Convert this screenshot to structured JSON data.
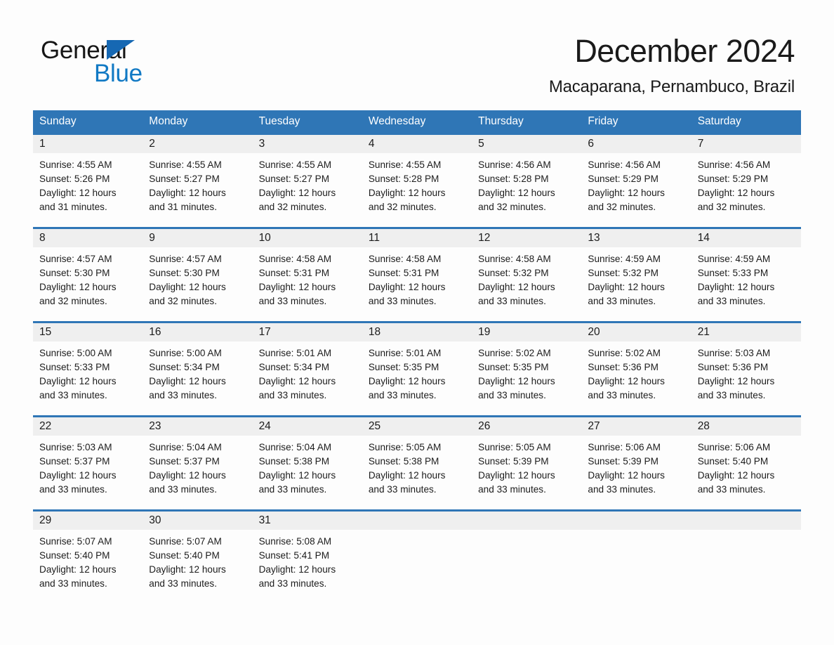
{
  "brand": {
    "name_part1": "General",
    "name_part2": "Blue",
    "triangle_color": "#1668b3",
    "blue_text_color": "#1179c4"
  },
  "header": {
    "month_title": "December 2024",
    "location": "Macaparana, Pernambuco, Brazil",
    "header_bg_color": "#2f76b6",
    "day_band_color": "#efefef"
  },
  "weekdays": [
    "Sunday",
    "Monday",
    "Tuesday",
    "Wednesday",
    "Thursday",
    "Friday",
    "Saturday"
  ],
  "weeks": [
    [
      {
        "day": "1",
        "sunrise": "Sunrise: 4:55 AM",
        "sunset": "Sunset: 5:26 PM",
        "daylight_line1": "Daylight: 12 hours",
        "daylight_line2": "and 31 minutes."
      },
      {
        "day": "2",
        "sunrise": "Sunrise: 4:55 AM",
        "sunset": "Sunset: 5:27 PM",
        "daylight_line1": "Daylight: 12 hours",
        "daylight_line2": "and 31 minutes."
      },
      {
        "day": "3",
        "sunrise": "Sunrise: 4:55 AM",
        "sunset": "Sunset: 5:27 PM",
        "daylight_line1": "Daylight: 12 hours",
        "daylight_line2": "and 32 minutes."
      },
      {
        "day": "4",
        "sunrise": "Sunrise: 4:55 AM",
        "sunset": "Sunset: 5:28 PM",
        "daylight_line1": "Daylight: 12 hours",
        "daylight_line2": "and 32 minutes."
      },
      {
        "day": "5",
        "sunrise": "Sunrise: 4:56 AM",
        "sunset": "Sunset: 5:28 PM",
        "daylight_line1": "Daylight: 12 hours",
        "daylight_line2": "and 32 minutes."
      },
      {
        "day": "6",
        "sunrise": "Sunrise: 4:56 AM",
        "sunset": "Sunset: 5:29 PM",
        "daylight_line1": "Daylight: 12 hours",
        "daylight_line2": "and 32 minutes."
      },
      {
        "day": "7",
        "sunrise": "Sunrise: 4:56 AM",
        "sunset": "Sunset: 5:29 PM",
        "daylight_line1": "Daylight: 12 hours",
        "daylight_line2": "and 32 minutes."
      }
    ],
    [
      {
        "day": "8",
        "sunrise": "Sunrise: 4:57 AM",
        "sunset": "Sunset: 5:30 PM",
        "daylight_line1": "Daylight: 12 hours",
        "daylight_line2": "and 32 minutes."
      },
      {
        "day": "9",
        "sunrise": "Sunrise: 4:57 AM",
        "sunset": "Sunset: 5:30 PM",
        "daylight_line1": "Daylight: 12 hours",
        "daylight_line2": "and 32 minutes."
      },
      {
        "day": "10",
        "sunrise": "Sunrise: 4:58 AM",
        "sunset": "Sunset: 5:31 PM",
        "daylight_line1": "Daylight: 12 hours",
        "daylight_line2": "and 33 minutes."
      },
      {
        "day": "11",
        "sunrise": "Sunrise: 4:58 AM",
        "sunset": "Sunset: 5:31 PM",
        "daylight_line1": "Daylight: 12 hours",
        "daylight_line2": "and 33 minutes."
      },
      {
        "day": "12",
        "sunrise": "Sunrise: 4:58 AM",
        "sunset": "Sunset: 5:32 PM",
        "daylight_line1": "Daylight: 12 hours",
        "daylight_line2": "and 33 minutes."
      },
      {
        "day": "13",
        "sunrise": "Sunrise: 4:59 AM",
        "sunset": "Sunset: 5:32 PM",
        "daylight_line1": "Daylight: 12 hours",
        "daylight_line2": "and 33 minutes."
      },
      {
        "day": "14",
        "sunrise": "Sunrise: 4:59 AM",
        "sunset": "Sunset: 5:33 PM",
        "daylight_line1": "Daylight: 12 hours",
        "daylight_line2": "and 33 minutes."
      }
    ],
    [
      {
        "day": "15",
        "sunrise": "Sunrise: 5:00 AM",
        "sunset": "Sunset: 5:33 PM",
        "daylight_line1": "Daylight: 12 hours",
        "daylight_line2": "and 33 minutes."
      },
      {
        "day": "16",
        "sunrise": "Sunrise: 5:00 AM",
        "sunset": "Sunset: 5:34 PM",
        "daylight_line1": "Daylight: 12 hours",
        "daylight_line2": "and 33 minutes."
      },
      {
        "day": "17",
        "sunrise": "Sunrise: 5:01 AM",
        "sunset": "Sunset: 5:34 PM",
        "daylight_line1": "Daylight: 12 hours",
        "daylight_line2": "and 33 minutes."
      },
      {
        "day": "18",
        "sunrise": "Sunrise: 5:01 AM",
        "sunset": "Sunset: 5:35 PM",
        "daylight_line1": "Daylight: 12 hours",
        "daylight_line2": "and 33 minutes."
      },
      {
        "day": "19",
        "sunrise": "Sunrise: 5:02 AM",
        "sunset": "Sunset: 5:35 PM",
        "daylight_line1": "Daylight: 12 hours",
        "daylight_line2": "and 33 minutes."
      },
      {
        "day": "20",
        "sunrise": "Sunrise: 5:02 AM",
        "sunset": "Sunset: 5:36 PM",
        "daylight_line1": "Daylight: 12 hours",
        "daylight_line2": "and 33 minutes."
      },
      {
        "day": "21",
        "sunrise": "Sunrise: 5:03 AM",
        "sunset": "Sunset: 5:36 PM",
        "daylight_line1": "Daylight: 12 hours",
        "daylight_line2": "and 33 minutes."
      }
    ],
    [
      {
        "day": "22",
        "sunrise": "Sunrise: 5:03 AM",
        "sunset": "Sunset: 5:37 PM",
        "daylight_line1": "Daylight: 12 hours",
        "daylight_line2": "and 33 minutes."
      },
      {
        "day": "23",
        "sunrise": "Sunrise: 5:04 AM",
        "sunset": "Sunset: 5:37 PM",
        "daylight_line1": "Daylight: 12 hours",
        "daylight_line2": "and 33 minutes."
      },
      {
        "day": "24",
        "sunrise": "Sunrise: 5:04 AM",
        "sunset": "Sunset: 5:38 PM",
        "daylight_line1": "Daylight: 12 hours",
        "daylight_line2": "and 33 minutes."
      },
      {
        "day": "25",
        "sunrise": "Sunrise: 5:05 AM",
        "sunset": "Sunset: 5:38 PM",
        "daylight_line1": "Daylight: 12 hours",
        "daylight_line2": "and 33 minutes."
      },
      {
        "day": "26",
        "sunrise": "Sunrise: 5:05 AM",
        "sunset": "Sunset: 5:39 PM",
        "daylight_line1": "Daylight: 12 hours",
        "daylight_line2": "and 33 minutes."
      },
      {
        "day": "27",
        "sunrise": "Sunrise: 5:06 AM",
        "sunset": "Sunset: 5:39 PM",
        "daylight_line1": "Daylight: 12 hours",
        "daylight_line2": "and 33 minutes."
      },
      {
        "day": "28",
        "sunrise": "Sunrise: 5:06 AM",
        "sunset": "Sunset: 5:40 PM",
        "daylight_line1": "Daylight: 12 hours",
        "daylight_line2": "and 33 minutes."
      }
    ],
    [
      {
        "day": "29",
        "sunrise": "Sunrise: 5:07 AM",
        "sunset": "Sunset: 5:40 PM",
        "daylight_line1": "Daylight: 12 hours",
        "daylight_line2": "and 33 minutes."
      },
      {
        "day": "30",
        "sunrise": "Sunrise: 5:07 AM",
        "sunset": "Sunset: 5:40 PM",
        "daylight_line1": "Daylight: 12 hours",
        "daylight_line2": "and 33 minutes."
      },
      {
        "day": "31",
        "sunrise": "Sunrise: 5:08 AM",
        "sunset": "Sunset: 5:41 PM",
        "daylight_line1": "Daylight: 12 hours",
        "daylight_line2": "and 33 minutes."
      },
      {
        "day": "",
        "sunrise": "",
        "sunset": "",
        "daylight_line1": "",
        "daylight_line2": ""
      },
      {
        "day": "",
        "sunrise": "",
        "sunset": "",
        "daylight_line1": "",
        "daylight_line2": ""
      },
      {
        "day": "",
        "sunrise": "",
        "sunset": "",
        "daylight_line1": "",
        "daylight_line2": ""
      },
      {
        "day": "",
        "sunrise": "",
        "sunset": "",
        "daylight_line1": "",
        "daylight_line2": ""
      }
    ]
  ]
}
